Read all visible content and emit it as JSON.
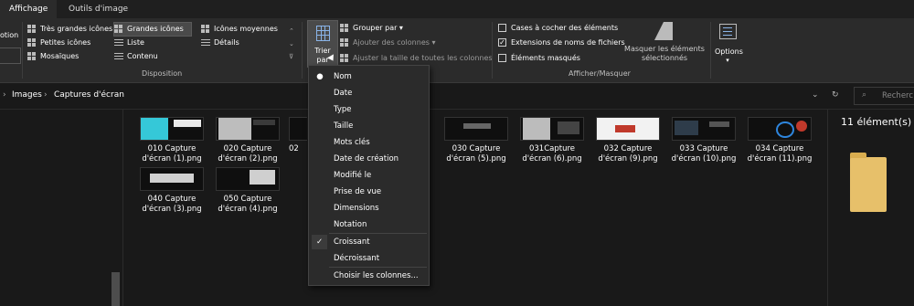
{
  "tabs": [
    "Affichage",
    "Outils d'image"
  ],
  "ribbon": {
    "left_cut_label": "otion",
    "layout": {
      "items": [
        "Très grandes icônes",
        "Grandes icônes",
        "Icônes moyennes",
        "Petites icônes",
        "Liste",
        "Détails",
        "Mosaïques",
        "Contenu"
      ],
      "group_label": "Disposition"
    },
    "sort": {
      "button_label": "Trier par",
      "group_by": "Grouper par",
      "add_columns": "Ajouter des colonnes",
      "fit_columns": "Ajuster la taille de toutes les colonnes"
    },
    "show_hide": {
      "item_checkboxes": "Cases à cocher des éléments",
      "file_extensions": "Extensions de noms de fichiers",
      "hidden_items": "Éléments masqués",
      "hide_selected": "Masquer les éléments sélectionnés",
      "group_label": "Afficher/Masquer"
    },
    "options": "Options"
  },
  "address": {
    "crumbs": [
      "Images",
      "Captures d'écran"
    ],
    "search_placeholder": "Recherc"
  },
  "files": [
    {
      "name": "010 Capture d'écran (1).png"
    },
    {
      "name": "020 Capture d'écran (2).png"
    },
    {
      "name": "02"
    },
    {
      "name": "030 Capture d'écran (5).png"
    },
    {
      "name": "031Capture d'écran (6).png"
    },
    {
      "name": "032 Capture d'écran (9).png"
    },
    {
      "name": "033 Capture d'écran (10).png"
    },
    {
      "name": "034 Capture d'écran (11).png"
    },
    {
      "name": "040 Capture d'écran (3).png"
    },
    {
      "name": "050 Capture d'écran (4).png"
    }
  ],
  "partial_name_fragment": "ng",
  "details": {
    "count": "11 élément(s)"
  },
  "menu": {
    "items": [
      "Nom",
      "Date",
      "Type",
      "Taille",
      "Mots clés",
      "Date de création",
      "Modifié le",
      "Prise de vue",
      "Dimensions",
      "Notation"
    ],
    "order_items": [
      "Croissant",
      "Décroissant"
    ],
    "choose_columns": "Choisir les colonnes..."
  }
}
